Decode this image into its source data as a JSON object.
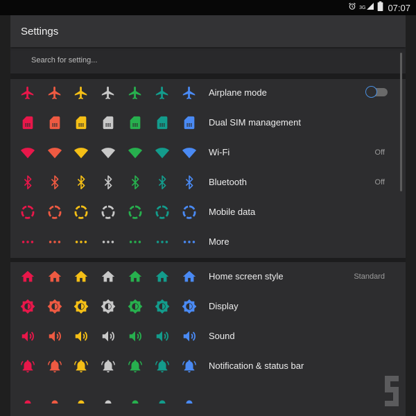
{
  "status_bar": {
    "time": "07:07",
    "network": "3G",
    "icons": [
      "alarm-icon",
      "network-signal-icon",
      "battery-icon"
    ]
  },
  "header": {
    "title": "Settings"
  },
  "search": {
    "placeholder": "Search for setting..."
  },
  "icon_colors": [
    "#e8174a",
    "#ee5a42",
    "#f5bf16",
    "#c8c8c8",
    "#27b04e",
    "#139c8c",
    "#4a8af4"
  ],
  "settings": [
    {
      "key": "airplane",
      "icon": "airplane-icon",
      "label": "Airplane mode",
      "toggle": true,
      "toggle_on": false
    },
    {
      "key": "dualsim",
      "icon": "sim-card-icon",
      "label": "Dual SIM management"
    },
    {
      "key": "wifi",
      "icon": "wifi-icon",
      "label": "Wi-Fi",
      "value": "Off"
    },
    {
      "key": "bluetooth",
      "icon": "bluetooth-icon",
      "label": "Bluetooth",
      "value": "Off"
    },
    {
      "key": "mobiledata",
      "icon": "mobile-data-icon",
      "label": "Mobile data"
    },
    {
      "key": "more",
      "icon": "more-dots-icon",
      "label": "More"
    },
    {
      "key": "home",
      "icon": "home-icon",
      "label": "Home screen style",
      "value": "Standard"
    },
    {
      "key": "display",
      "icon": "brightness-icon",
      "label": "Display"
    },
    {
      "key": "sound",
      "icon": "speaker-icon",
      "label": "Sound"
    },
    {
      "key": "notification",
      "icon": "bell-icon",
      "label": "Notification & status bar"
    },
    {
      "key": "partial",
      "icon": "dot-icon",
      "label": ""
    }
  ]
}
